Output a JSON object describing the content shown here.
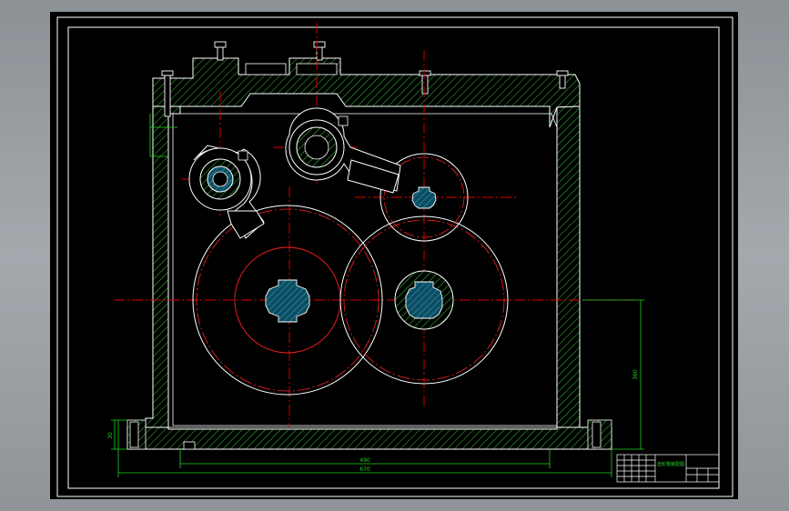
{
  "drawing": {
    "background_color": "#000000",
    "frame_color": "#ffffff",
    "outline_color": "#ffffff",
    "hatch_color": "#2db82d",
    "centerline_color": "#e00000",
    "pitch_circle_color": "#ff2020",
    "shaft_fill_color": "#1f6f87",
    "dimension_color": "#21d421"
  },
  "dimensions": {
    "overall_width": "670",
    "base_width": "490",
    "center_height": "360",
    "base_thickness": "30"
  },
  "title_block": {
    "drawing_name": "齿轮箱装配图"
  }
}
